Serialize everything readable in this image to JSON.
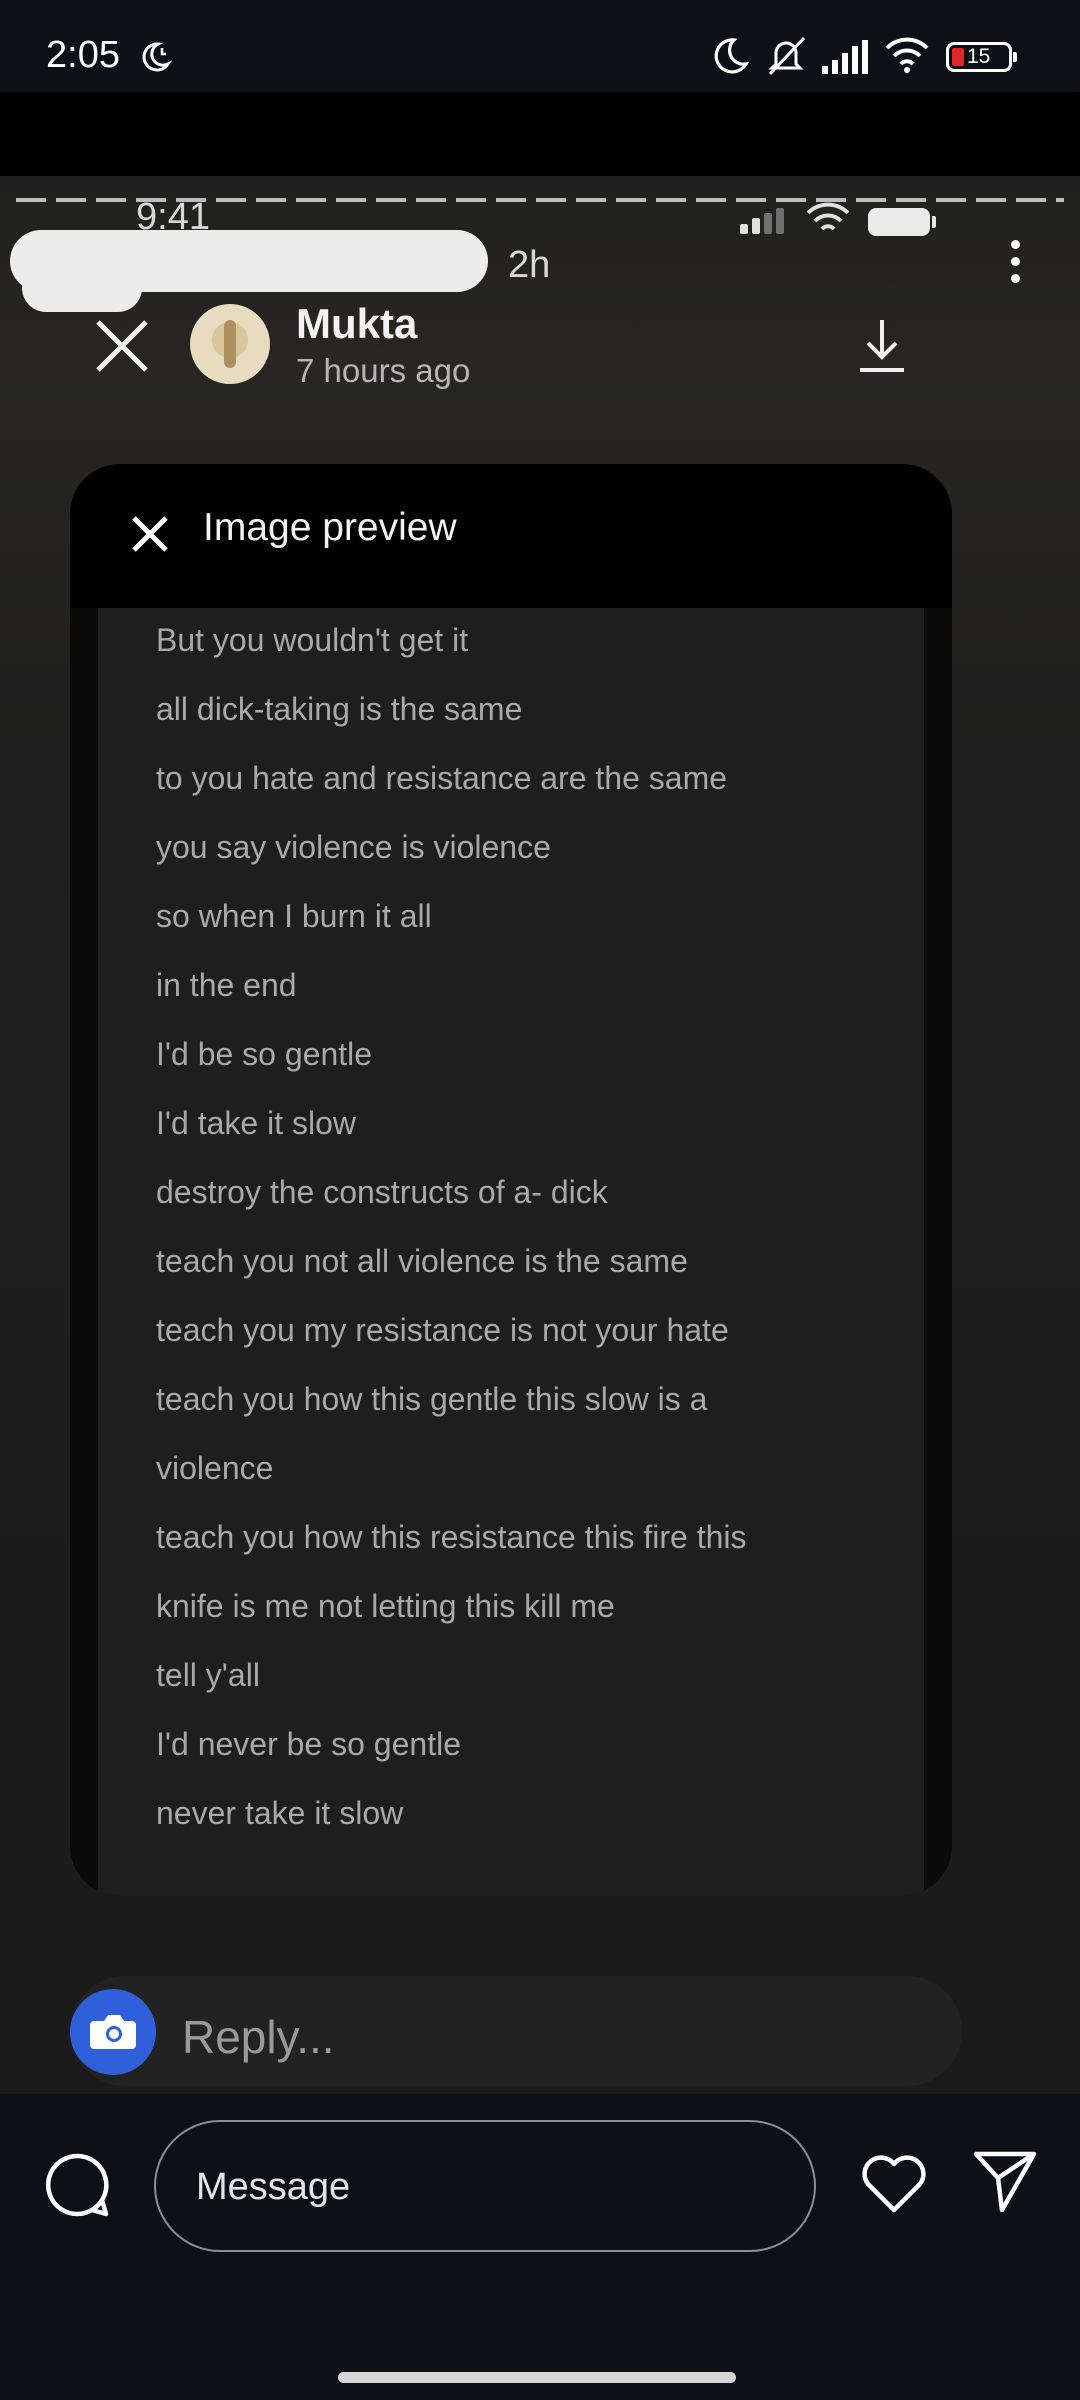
{
  "status_bar": {
    "time": "2:05",
    "battery_level": "15",
    "icons": [
      "moon-clock-icon",
      "moon-icon",
      "silent-icon",
      "signal-icon",
      "wifi-icon",
      "battery-icon"
    ]
  },
  "story": {
    "inner_status_time": "9:41",
    "age": "2h",
    "poster": {
      "name": "Mukta",
      "time": "7 hours ago"
    },
    "preview": {
      "title": "Image preview",
      "lines": [
        "But you wouldn't get it",
        "all dick-taking is the same",
        "to you hate and resistance are the same",
        "you say violence is violence",
        "so when I burn it all",
        "in the end",
        "I'd be so gentle",
        "I'd take it slow",
        "destroy the constructs of a- dick",
        "teach you not all violence is the same",
        "teach you my resistance is not your hate",
        "teach you how this gentle this slow is a",
        "violence",
        "teach you how this resistance this fire this",
        "knife is me not letting this kill me",
        "tell y'all",
        "I'd never be so gentle",
        "never take it slow"
      ]
    },
    "reply_label": "Reply...",
    "accent": "#2f5fd9"
  },
  "bottom_bar": {
    "message_placeholder": "Message",
    "icons": [
      "chat-bubble-icon",
      "heart-icon",
      "send-icon"
    ]
  }
}
